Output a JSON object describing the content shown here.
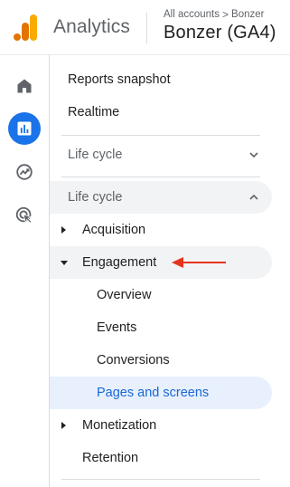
{
  "header": {
    "app_name": "Analytics",
    "breadcrumb": {
      "account": "All accounts",
      "separator": ">",
      "property": "Bonzer"
    },
    "property_name": "Bonzer (GA4)"
  },
  "rail": {
    "items": [
      {
        "icon": "home-icon"
      },
      {
        "icon": "reports-icon",
        "active": true
      },
      {
        "icon": "explore-icon"
      },
      {
        "icon": "advertising-icon"
      }
    ]
  },
  "nav": {
    "reports_snapshot": "Reports snapshot",
    "realtime": "Realtime",
    "section1": "Life cycle",
    "section2": "Life cycle",
    "acquisition": "Acquisition",
    "engagement": "Engagement",
    "overview": "Overview",
    "events": "Events",
    "conversions": "Conversions",
    "pages_and_screens": "Pages and screens",
    "monetization": "Monetization",
    "retention": "Retention"
  },
  "colors": {
    "accent": "#1a73e8",
    "active_text": "#1967d2",
    "active_bg": "#e8f0fe",
    "highlight_bg": "#f1f3f4",
    "annotation_arrow": "#e8331c",
    "logo_orange": "#f9ab00",
    "logo_dark_orange": "#e37400"
  }
}
